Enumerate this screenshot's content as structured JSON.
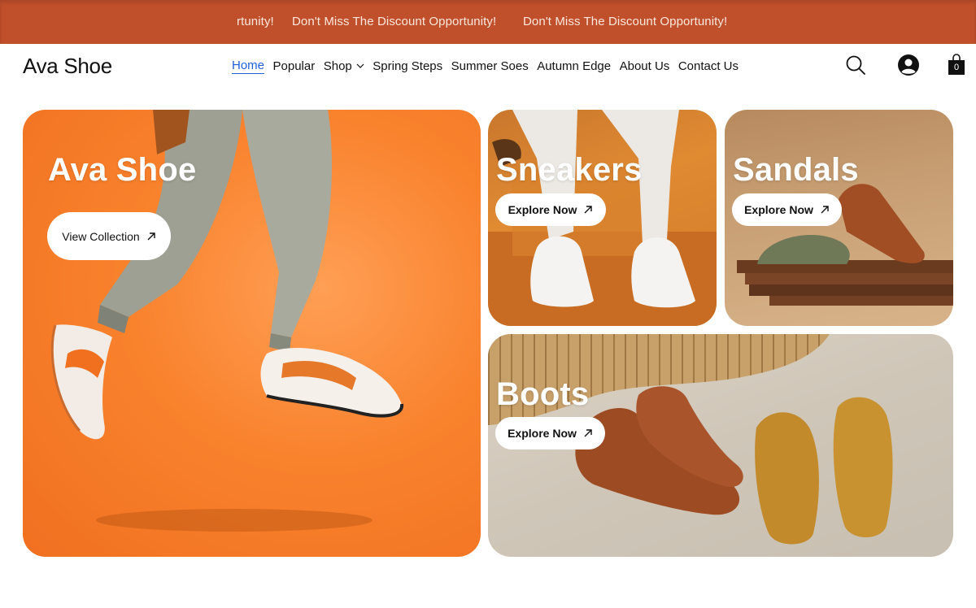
{
  "announcement": {
    "messages": [
      "rtunity!",
      "Don't Miss The Discount Opportunity!",
      "Don't Miss The Discount Opportunity!"
    ]
  },
  "header": {
    "logo": "Ava Shoe",
    "nav": [
      {
        "label": "Home",
        "active": true
      },
      {
        "label": "Popular"
      },
      {
        "label": "Shop",
        "dropdown": true
      },
      {
        "label": "Spring Steps"
      },
      {
        "label": "Summer Soes"
      },
      {
        "label": "Autumn Edge"
      },
      {
        "label": "About Us"
      },
      {
        "label": "Contact Us"
      }
    ],
    "cart_count": "0",
    "icons": [
      "search-icon",
      "account-icon",
      "shopping-bag-icon"
    ]
  },
  "hero": {
    "title": "Ava Shoe",
    "button": "View Collection"
  },
  "categories": [
    {
      "title": "Sneakers",
      "button": "Explore Now"
    },
    {
      "title": "Sandals",
      "button": "Explore Now"
    },
    {
      "title": "Boots",
      "button": "Explore Now"
    }
  ],
  "colors": {
    "announcement_bg": "#c04f2b",
    "accent_link": "#1f5fd6",
    "hero_orange": "#f9822d"
  }
}
